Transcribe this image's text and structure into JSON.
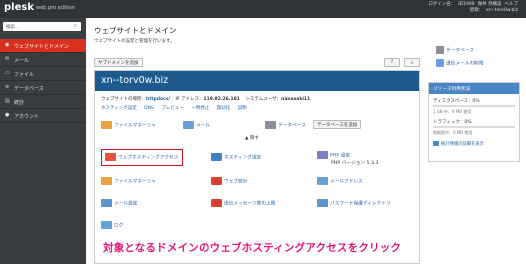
{
  "topbar": {
    "logo": "plesk",
    "edition": "web pro edition",
    "login_label": "ログイン名：",
    "login_id": "ID1999",
    "user_name": "保井 奈緒美",
    "help": "ヘルプ",
    "subscription_label": "登録：",
    "subscription_domain": "xn--torv0w.biz"
  },
  "sidebar": {
    "search_placeholder": "検索...",
    "items": [
      {
        "label": "ウェブサイトとドメイン",
        "icon": "globe-icon",
        "active": true
      },
      {
        "label": "メール",
        "icon": "mail-icon",
        "active": false
      },
      {
        "label": "ファイル",
        "icon": "folder-icon",
        "active": false
      },
      {
        "label": "データベース",
        "icon": "database-icon",
        "active": false
      },
      {
        "label": "統計",
        "icon": "stats-icon",
        "active": false
      },
      {
        "label": "アカウント",
        "icon": "account-icon",
        "active": false
      }
    ]
  },
  "main": {
    "title": "ウェブサイトとドメイン",
    "description": "ウェブサイトの設定と管理を行います。",
    "add_subdomain": "サブドメインを追加",
    "domain": "xn--torv0w.biz",
    "site_location_label": "ウェブサイトの場所：",
    "site_location": "httpdocs/",
    "ip_label": "IP アドレス：",
    "ip": "119.82.26.181",
    "sysuser_label": "システムユーザ：",
    "sysuser": "nanasaki11",
    "quicklinks": [
      "ホスティング設定",
      "DNS",
      "プレビュー",
      "一時停止",
      "無効化",
      "説明"
    ],
    "row1": [
      {
        "label": "ファイルマネージャ",
        "icon": "folder-icon"
      },
      {
        "label": "メール",
        "icon": "mail-icon"
      },
      {
        "label": "データベース",
        "icon": "database-icon"
      }
    ],
    "add_database": "データベースを追加",
    "collapse": "▲ 隠す",
    "tools": [
      {
        "label": "ウェブホスティングアクセス",
        "icon": "hosting-access-icon",
        "color": "#e5533c"
      },
      {
        "label": "ホスティング設定",
        "icon": "hosting-settings-icon",
        "color": "#3f7fc4"
      },
      {
        "label": "PHP 設定",
        "icon": "php-icon",
        "color": "#7b7fc4"
      },
      {
        "label": "ファイルマネージャ",
        "icon": "folder-icon",
        "color": "#e8a33c"
      },
      {
        "label": "ウェブ統計",
        "icon": "web-stats-icon",
        "color": "#d9402f"
      },
      {
        "label": "メールアドレス",
        "icon": "mail-address-icon",
        "color": "#6aa0d8"
      },
      {
        "label": "メール設定",
        "icon": "mail-settings-icon",
        "color": "#5f95cf"
      },
      {
        "label": "送信メッセージ数の上限",
        "icon": "mail-limit-icon",
        "color": "#d9402f"
      },
      {
        "label": "パスワード保護ディレクトリ",
        "icon": "password-dir-icon",
        "color": "#5f95cf"
      },
      {
        "label": "ログ",
        "icon": "log-icon",
        "color": "#6aa0d8"
      }
    ],
    "php_version": "PHP バージョン 5.3.3"
  },
  "right": {
    "links": [
      "データベース",
      "送信メールの制限"
    ],
    "resource_title": "リソース利用状況",
    "disk_label": "ディスクスペース：0%",
    "disk_detail": "1 GB 中、0 MB 使用",
    "disk_fraction": 0,
    "traffic_label": "トラフィック：0%",
    "traffic_detail": "無制限中、0 MB 使用",
    "traffic_fraction": 0,
    "stats_link": "統計情報の詳細を表示"
  },
  "caption": "対象となるドメインのウェブホスティングアクセスをクリック",
  "colors": {
    "accent": "#d9311f",
    "domain_bar": "#1f5a8f",
    "link": "#2a64a6",
    "caption": "#e6167a",
    "highlight": "#d31222"
  }
}
